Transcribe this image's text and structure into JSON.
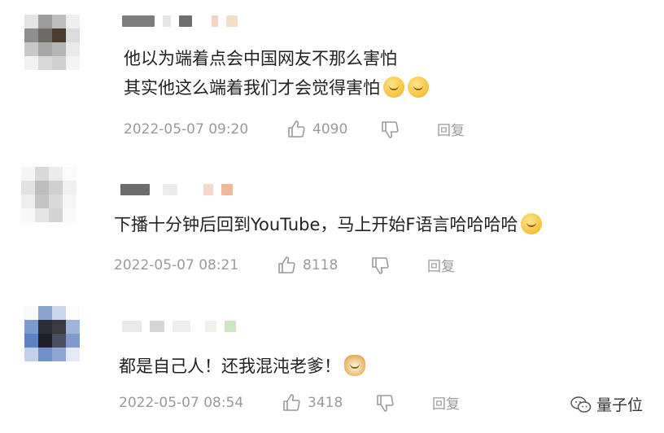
{
  "comments": [
    {
      "lines": [
        "他以为端着点会中国网友不那么害怕",
        "其实他这么端着我们才会觉得害怕"
      ],
      "emojis": [
        "snicker-emoji",
        "snicker-emoji"
      ],
      "time": "2022-05-07 09:20",
      "likes": "4090",
      "reply_label": "回复"
    },
    {
      "lines": [
        "下播十分钟后回到YouTube，马上开始F语言哈哈哈哈"
      ],
      "emojis": [
        "laugh-cry-emoji"
      ],
      "time": "2022-05-07 08:21",
      "likes": "8118",
      "reply_label": "回复"
    },
    {
      "lines": [
        "都是自己人！还我混沌老爹！"
      ],
      "emojis": [
        "doge-emoji"
      ],
      "time": "2022-05-07 08:54",
      "likes": "3418",
      "reply_label": "回复"
    }
  ],
  "watermark": {
    "text": "量子位",
    "icon": "wechat-icon"
  },
  "colors": {
    "meta": "#9a9a9a",
    "text": "#222222"
  }
}
